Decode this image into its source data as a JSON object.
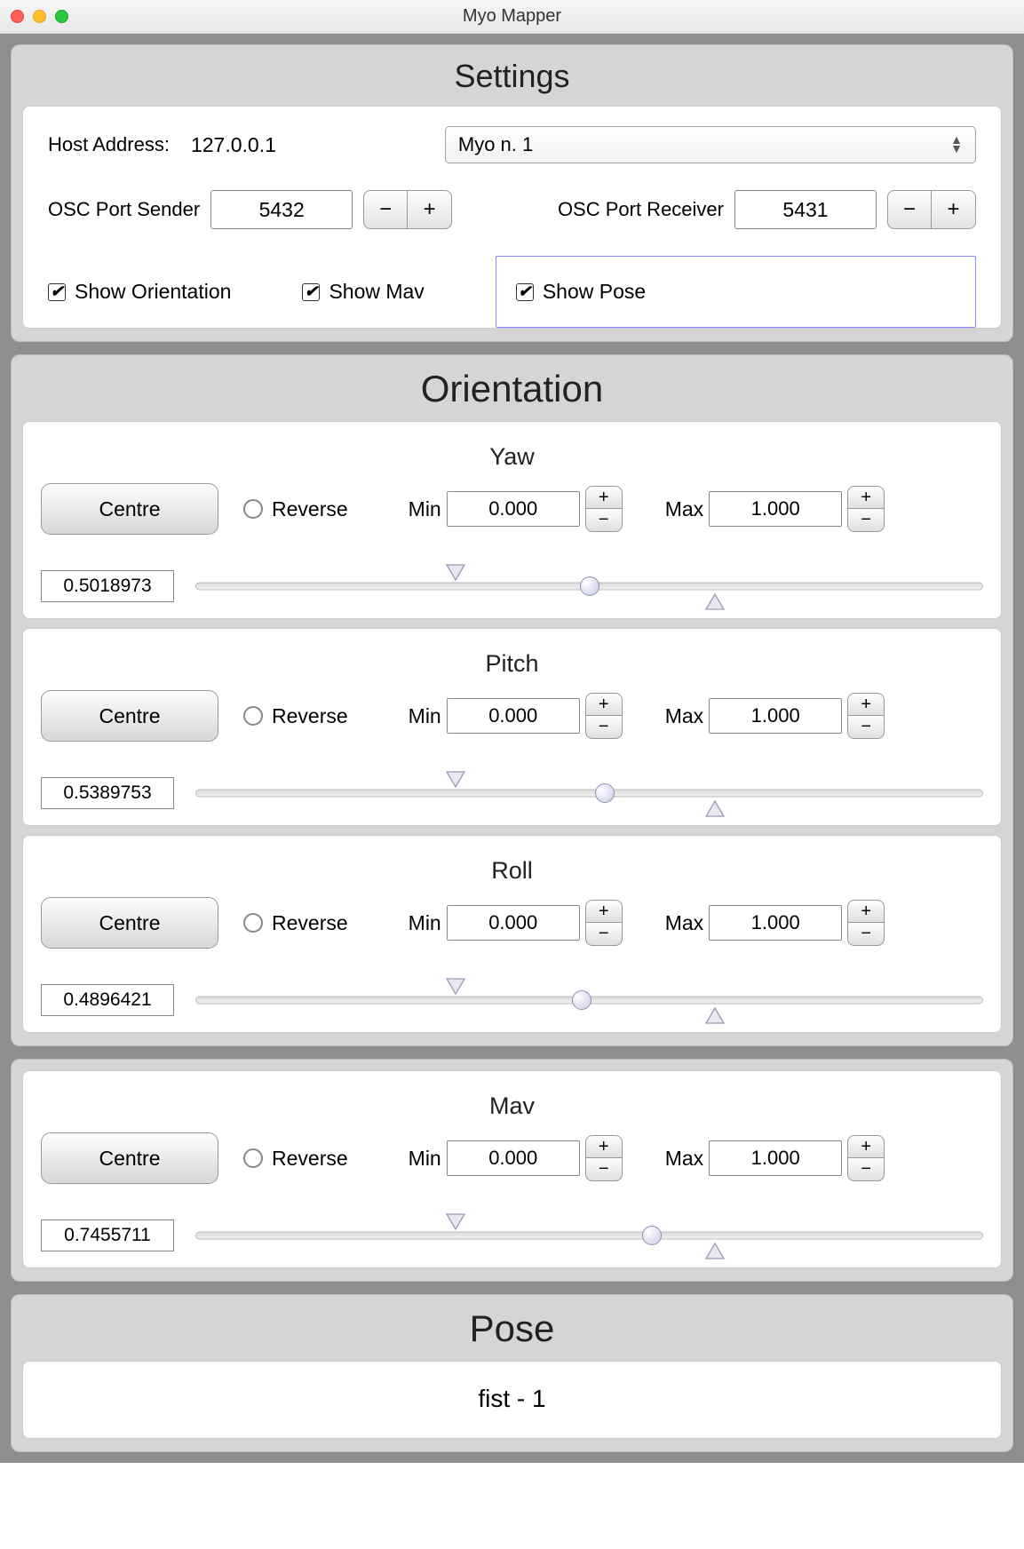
{
  "window": {
    "title": "Myo Mapper"
  },
  "settings": {
    "title": "Settings",
    "hostLabel": "Host Address:",
    "hostValue": "127.0.0.1",
    "device": "Myo n. 1",
    "senderLabel": "OSC Port Sender",
    "senderValue": "5432",
    "receiverLabel": "OSC Port Receiver",
    "receiverValue": "5431",
    "showOrientation": "Show Orientation",
    "showMav": "Show Mav",
    "showPose": "Show Pose"
  },
  "orientation": {
    "title": "Orientation",
    "centre": "Centre",
    "reverse": "Reverse",
    "minLabel": "Min",
    "maxLabel": "Max",
    "yaw": {
      "title": "Yaw",
      "min": "0.000",
      "max": "1.000",
      "value": "0.5018973",
      "thumb": 50,
      "markL": 33,
      "markR": 66
    },
    "pitch": {
      "title": "Pitch",
      "min": "0.000",
      "max": "1.000",
      "value": "0.5389753",
      "thumb": 52,
      "markL": 33,
      "markR": 66
    },
    "roll": {
      "title": "Roll",
      "min": "0.000",
      "max": "1.000",
      "value": "0.4896421",
      "thumb": 49,
      "markL": 33,
      "markR": 66
    }
  },
  "mav": {
    "title": "Mav",
    "centre": "Centre",
    "reverse": "Reverse",
    "minLabel": "Min",
    "maxLabel": "Max",
    "min": "0.000",
    "max": "1.000",
    "value": "0.7455711",
    "thumb": 58,
    "markL": 33,
    "markR": 66
  },
  "pose": {
    "title": "Pose",
    "value": "fist - 1"
  }
}
